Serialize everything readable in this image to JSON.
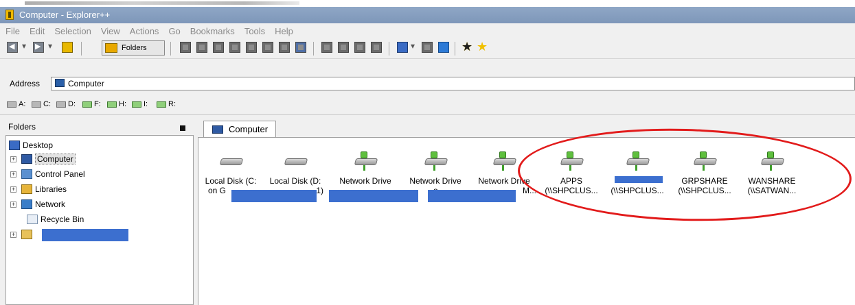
{
  "window": {
    "title": "Computer - Explorer++"
  },
  "menu": [
    "File",
    "Edit",
    "Selection",
    "View",
    "Actions",
    "Go",
    "Bookmarks",
    "Tools",
    "Help"
  ],
  "toolbar": {
    "folders_label": "Folders"
  },
  "address": {
    "label": "Address",
    "value": "Computer"
  },
  "drives": [
    "A:",
    "C:",
    "D:",
    "F:",
    "H:",
    "I:",
    "R:"
  ],
  "folders_pane": {
    "title": "Folders",
    "tree": [
      {
        "label": "Desktop"
      },
      {
        "label": "Computer"
      },
      {
        "label": "Control Panel"
      },
      {
        "label": "Libraries"
      },
      {
        "label": "Network"
      },
      {
        "label": "Recycle Bin"
      }
    ]
  },
  "tabs": [
    {
      "label": "Computer"
    }
  ],
  "items": [
    {
      "name": "Local Disk (C:",
      "sub": "on G"
    },
    {
      "name": "Local Disk (D:",
      "sub": "1)"
    },
    {
      "name": "Network Drive",
      "sub": ""
    },
    {
      "name": "Network Drive",
      "sub": "o"
    },
    {
      "name": "Network Drive",
      "sub": "M..."
    },
    {
      "name": "APPS",
      "sub": "(\\\\SHPCLUS..."
    },
    {
      "name": "",
      "sub": "(\\\\SHPCLUS..."
    },
    {
      "name": "GRPSHARE",
      "sub": "(\\\\SHPCLUS..."
    },
    {
      "name": "WANSHARE",
      "sub": "(\\\\SATWAN..."
    }
  ],
  "colors": {
    "highlight_ellipse": "#e21b1b",
    "redaction": "#3c6fcf",
    "titlebar": "#8fa7c6"
  }
}
